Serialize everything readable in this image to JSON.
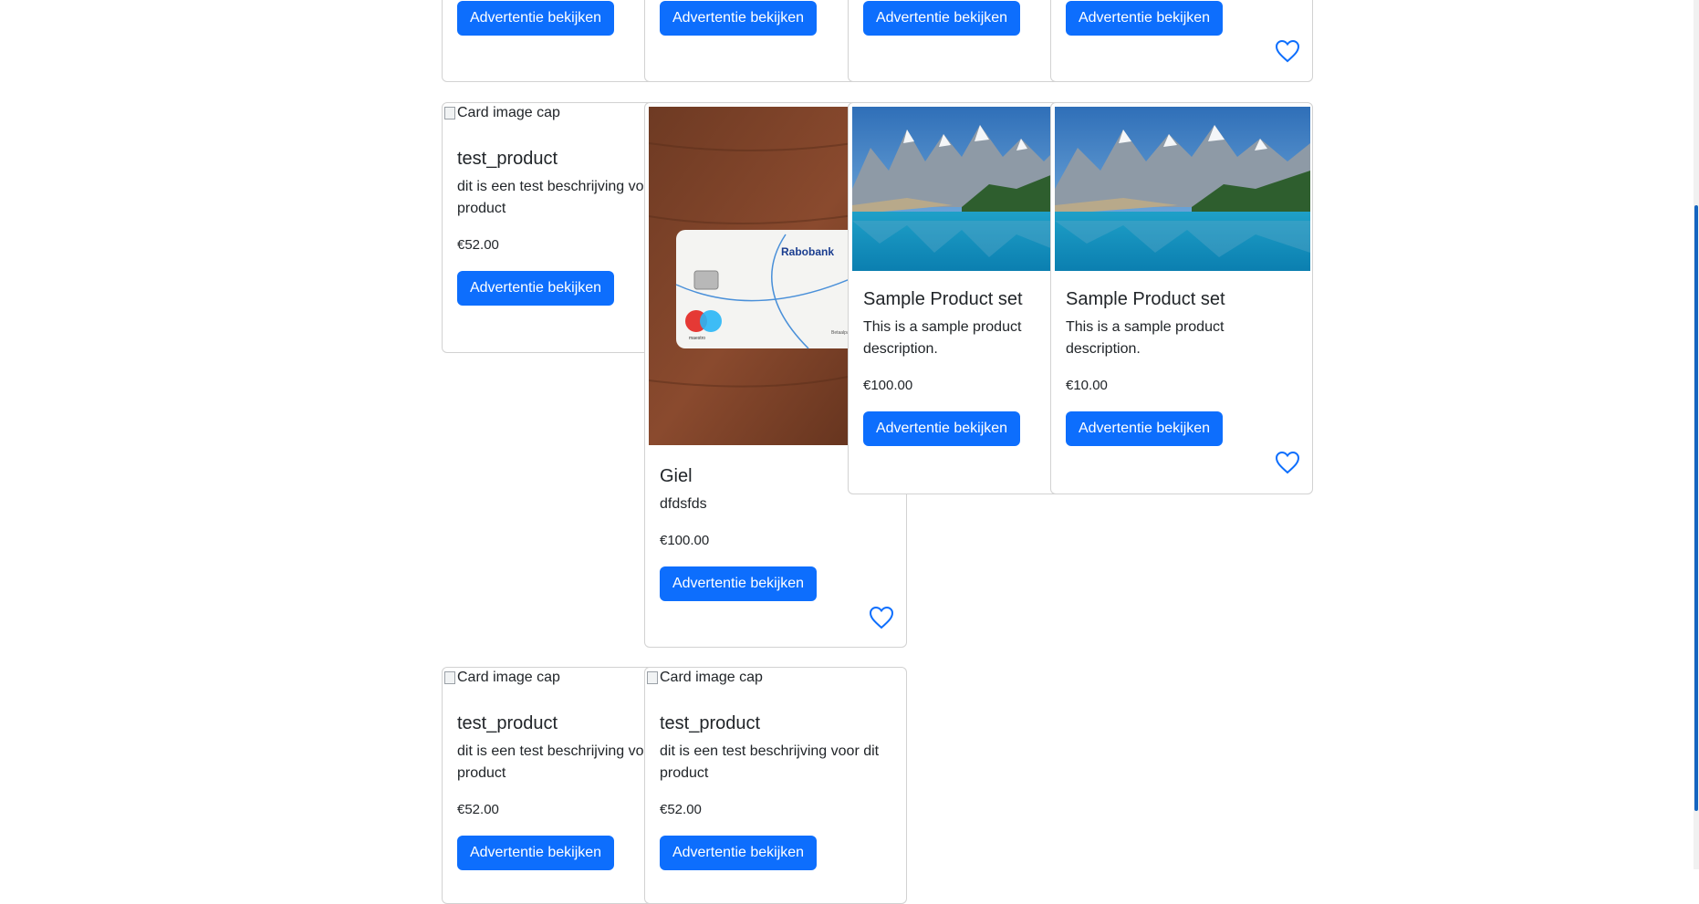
{
  "common": {
    "button_label": "Advertentie bekijken",
    "image_alt": "Card image cap"
  },
  "cards": {
    "top1": {},
    "top2": {},
    "top3": {},
    "top4": {},
    "r2c1": {
      "title": "test_product",
      "description": "dit is een test beschrijving voor dit product",
      "price": "€52.00"
    },
    "r2c2": {
      "title": "Giel",
      "description": "dfdsfds",
      "price": "€100.00",
      "image": "rabobank-card-photo"
    },
    "r2c3": {
      "title": "Sample Product set",
      "description": "This is a sample product description.",
      "price": "€100.00",
      "image": "mountain-lake-photo"
    },
    "r2c4": {
      "title": "Sample Product set",
      "description": "This is a sample product description.",
      "price": "€10.00",
      "image": "mountain-lake-photo"
    },
    "r3c1": {
      "title": "test_product",
      "description": "dit is een test beschrijving voor dit product",
      "price": "€52.00"
    },
    "r3c2": {
      "title": "test_product",
      "description": "dit is een test beschrijving voor dit product",
      "price": "€52.00"
    }
  },
  "photo_text": {
    "bank_name": "Rabobank",
    "card_brand": "maestro",
    "card_type": "Betaalpas"
  },
  "colors": {
    "primary": "#0d6efd",
    "border": "#dee2e6",
    "scrollbar": "#1565c0"
  },
  "icons": {
    "favorite": "heart-outline-icon"
  }
}
